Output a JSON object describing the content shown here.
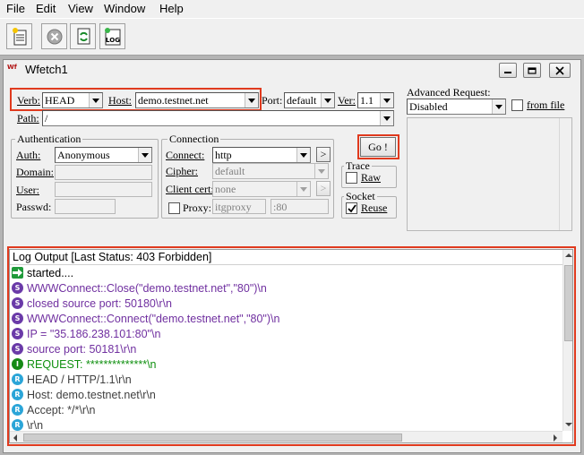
{
  "menu": [
    "File",
    "Edit",
    "View",
    "Window",
    "Help"
  ],
  "toolbar": {
    "icons": [
      "new-document-icon",
      "stop-icon",
      "refresh-icon",
      "log-icon"
    ],
    "log_label": "LOG"
  },
  "window": {
    "title": "Wfetch1",
    "icon_text": "Wf",
    "buttons": [
      "minimize-icon",
      "restore-icon",
      "close-icon"
    ]
  },
  "request": {
    "verb_label": "Verb:",
    "verb_value": "HEAD",
    "host_label": "Host:",
    "host_value": "demo.testnet.net",
    "port_label": "Port:",
    "port_value": "default",
    "ver_label": "Ver:",
    "ver_value": "1.1",
    "path_label": "Path:",
    "path_value": "/"
  },
  "auth": {
    "title": "Authentication",
    "auth_label": "Auth:",
    "auth_value": "Anonymous",
    "domain_label": "Domain:",
    "user_label": "User:",
    "passwd_label": "Passwd:"
  },
  "connection": {
    "title": "Connection",
    "connect_label": "Connect:",
    "connect_value": "http",
    "cipher_label": "Cipher:",
    "cipher_value": "default",
    "client_cert_label": "Client cert:",
    "client_cert_value": "none",
    "proxy_label": "Proxy:",
    "proxy_host": "itgproxy",
    "proxy_port": ":80",
    "more_button": ">"
  },
  "go_button": "Go !",
  "trace": {
    "title": "Trace",
    "raw_label": "Raw",
    "raw_checked": false
  },
  "socket": {
    "title": "Socket",
    "reuse_label": "Reuse",
    "reuse_checked": true
  },
  "advanced": {
    "label": "Advanced Request:",
    "value": "Disabled",
    "from_file_label": "from file"
  },
  "log": {
    "header": "Log Output [Last Status: 403 Forbidden]",
    "rows": [
      {
        "icon": "arrow",
        "text": "started....",
        "color": "#000000"
      },
      {
        "icon": "S",
        "text": "WWWConnect::Close(\"demo.testnet.net\",\"80\")\\n",
        "color": "#7030a0"
      },
      {
        "icon": "S",
        "text": "closed source port: 50180\\r\\n",
        "color": "#7030a0"
      },
      {
        "icon": "S",
        "text": "WWWConnect::Connect(\"demo.testnet.net\",\"80\")\\n",
        "color": "#7030a0"
      },
      {
        "icon": "S",
        "text": "IP = \"35.186.238.101:80\"\\n",
        "color": "#7030a0"
      },
      {
        "icon": "S",
        "text": "source port: 50181\\r\\n",
        "color": "#7030a0"
      },
      {
        "icon": "I",
        "text": "REQUEST: **************\\n",
        "color": "#109010"
      },
      {
        "icon": "R",
        "text": "HEAD / HTTP/1.1\\r\\n",
        "color": "#404040"
      },
      {
        "icon": "R",
        "text": "Host: demo.testnet.net\\r\\n",
        "color": "#404040"
      },
      {
        "icon": "R",
        "text": "Accept: */*\\r\\n",
        "color": "#404040"
      },
      {
        "icon": "R",
        "text": "\\r\\n",
        "color": "#404040"
      }
    ]
  },
  "colors": {
    "highlight": "#e03a1e",
    "s_icon": "#6a3aa8",
    "i_icon": "#168a16",
    "r_icon": "#2ba5d8",
    "arrow_icon": "#1f9a3a"
  }
}
